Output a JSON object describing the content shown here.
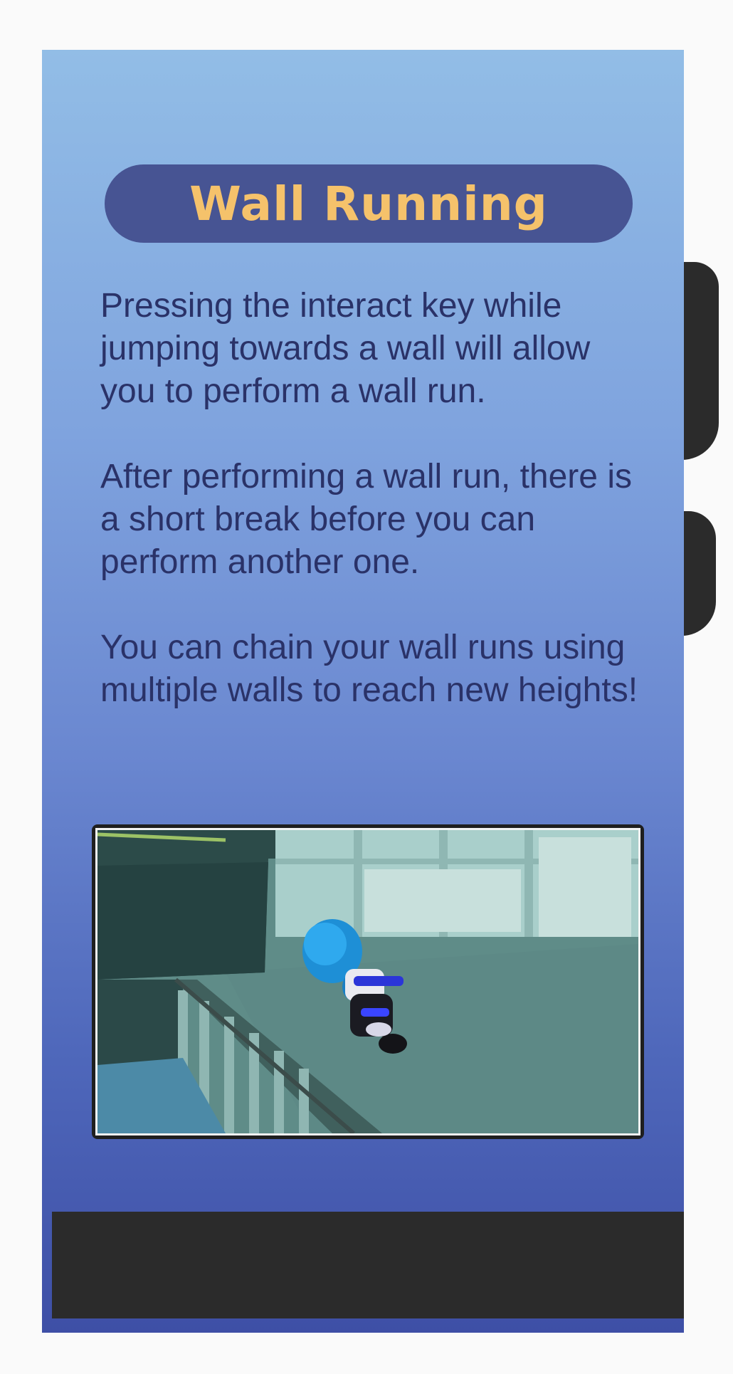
{
  "title": "Wall Running",
  "paragraphs": [
    "Pressing the interact key while jumping towards a wall will allow you to perform a wall run.",
    "After performing a wall run, there is a short break before you can perform another one.",
    "You can chain your wall runs using multiple walls to reach new heights!"
  ],
  "screenshot": {
    "subject": "character performing wall run"
  },
  "colors": {
    "title_text": "#f5c26b",
    "title_pill": "#475493",
    "body_text": "#2a3268"
  }
}
